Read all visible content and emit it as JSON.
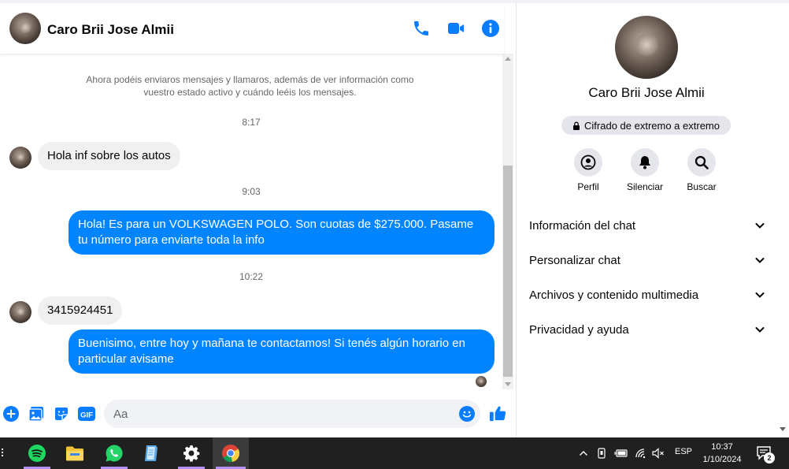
{
  "chat": {
    "contact_name": "Caro Brii Jose Almii",
    "system_note": "Ahora podéis enviaros mensajes y llamaros, además de ver información como vuestro estado activo y cuándo leéis los mensajes.",
    "timestamps": [
      "8:17",
      "9:03",
      "10:22"
    ],
    "messages": [
      {
        "direction": "in",
        "text": "Hola inf sobre los autos"
      },
      {
        "direction": "out",
        "text": "Hola! Es para un VOLKSWAGEN POLO. Son cuotas de $275.000. Pasame tu número para enviarte toda la info"
      },
      {
        "direction": "in",
        "text": "3415924451"
      },
      {
        "direction": "out",
        "text": "Buenisimo, entre hoy y mañana te contactamos! Si tenés algún horario en particular avisame"
      }
    ],
    "composer_placeholder": "Aa",
    "composer_icons": [
      "plus-icon",
      "image-icon",
      "sticker-icon",
      "gif-icon",
      "emoji-icon",
      "like-icon"
    ],
    "gif_label": "GIF"
  },
  "panel": {
    "name": "Caro Brii Jose Almii",
    "encryption_badge": "Cifrado de extremo a extremo",
    "actions": [
      {
        "label": "Perfil",
        "icon": "profile-icon"
      },
      {
        "label": "Silenciar",
        "icon": "bell-icon"
      },
      {
        "label": "Buscar",
        "icon": "search-icon"
      }
    ],
    "sections": [
      "Información del chat",
      "Personalizar chat",
      "Archivos y contenido multimedia",
      "Privacidad y ayuda"
    ]
  },
  "taskbar": {
    "apps": [
      "spotify-icon",
      "file-explorer-icon",
      "whatsapp-icon",
      "notes-icon",
      "settings-icon",
      "chrome-icon"
    ],
    "language": "ESP",
    "time": "10:37",
    "date": "1/10/2024",
    "notification_count": "2"
  },
  "colors": {
    "accent": "#0084ff",
    "header_icon": "#0a7cff",
    "taskbar": "#202020",
    "taskbar_indicator": "#b18ff3"
  }
}
